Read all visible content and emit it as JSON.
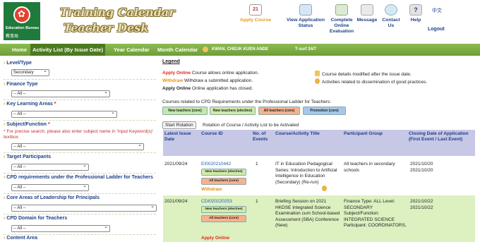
{
  "header": {
    "logo_en": "Education Bureau",
    "logo_zh": "教育局",
    "title_line1": "Training Calendar",
    "title_line2": "Teacher Desk",
    "calendar_icon_day": "21",
    "nav": {
      "apply_course": "Apply Course",
      "view_application_status": "View Application Status",
      "complete_online_evaluation": "Complete Online Evaluation",
      "message": "Message",
      "contact_us": "Contact Us",
      "help": "Help",
      "help_glyph": "?",
      "language": "中文",
      "logout": "Logout"
    }
  },
  "menubar": {
    "home": "Home",
    "activity_list": "Activity List (By Issue Date)",
    "year_calendar": "Year Calendar",
    "month_calendar": "Month Calendar",
    "user_name": "KWAN, CHEUK KUEN ANDE",
    "tsurf": "T-surf 24/7"
  },
  "sidebar": {
    "level_type_label": "Level/Type",
    "level_type_value": "Secondary",
    "finance_type_label": "Finance Type",
    "finance_type_value": "-- All --",
    "key_learning_areas_label": "Key Learning Areas",
    "key_learning_areas_value": "-- All --",
    "subject_function_label": "Subject/Function",
    "subject_hint": "* For precise search, please also enter subject name in 'Input Keyword(s)' textbox",
    "subject_value": "-- All --",
    "target_participants_label": "Target Participants",
    "target_participants_value": "-- All --",
    "cpd_ladder_label": "CPD requirements under the Professional Ladder for Teachers",
    "cpd_ladder_value": "-- All --",
    "core_areas_label": "Core Areas of Leadership for Principals",
    "core_areas_value": "-- All --",
    "cpd_domain_label": "CPD Domain for Teachers",
    "cpd_domain_value": "-- All --",
    "content_area_label": "Content Area",
    "required_mark": "*"
  },
  "legend": {
    "title": "Legend",
    "apply_online_term": "Apply Online",
    "apply_online_desc": "Course allows online application.",
    "withdraw_term": "Withdraw",
    "withdraw_desc": "Withdraw a submitted application.",
    "apply_online_closed_term": "Apply Online",
    "apply_online_closed_desc": "Online application has closed.",
    "modified_desc": "Course details modified after the issue date.",
    "good_practices_desc": "Activities related to dissemination of good practices."
  },
  "ladder": {
    "text": "Courses related to CPD Requirements under the Professional Ladder for Teachers:",
    "pills": [
      "New teachers (core)",
      "New teachers (elective)",
      "All teachers (core)",
      "Promotion (core)"
    ]
  },
  "rotation": {
    "button": "Start Rotation",
    "text": "Rotation of Course / Activity List to be Activated"
  },
  "table": {
    "headers": {
      "issue_date": "Latest Issue Date",
      "course_id": "Course ID",
      "events": "No. of Events",
      "title": "Course/Activity Title",
      "participant": "Participant Group",
      "closing": "Closing Date of Application (First Event / Last Event)"
    },
    "rows": [
      {
        "issue_date": "2021/09/24",
        "course_id": "EI0020210442",
        "pill1": "New teachers (elective)",
        "pill2": "All teachers (core)",
        "status": "Withdraw",
        "events": "1",
        "title": "IT in Education Pedagogical Series: Introduction to Artificial Intelligence in Education (Secondary) (Re-run)",
        "participant": "All teachers in secondary schools",
        "closing_first": "2021/10/20",
        "closing_last": "2021/10/20"
      },
      {
        "issue_date": "2021/09/24",
        "course_id": "CDI020220253",
        "pill1": "New teachers (elective)",
        "pill2": "All teachers (core)",
        "status": "Apply Online",
        "events": "1",
        "title": "Briefing Session on 2021 HKDSE Integrated Science Examination cum School-based Assessment (SBA) Conference (New)",
        "participant": "Finance Type: ALL Level: SECONDARY Subject/Function: INTEGRATED SCIENCE Participant: COORDINATORS,",
        "closing_first": "2021/10/22",
        "closing_last": "2021/10/22"
      }
    ]
  },
  "colors": {
    "green_bar": "#7aad43",
    "active_tab": "#4c7a1f",
    "link_blue": "#1e3f87",
    "apply_red": "#e1271a",
    "withdraw_orange": "#e98f0c",
    "table_header": "#c7c7e6",
    "row_highlight": "#dcf0c0"
  }
}
